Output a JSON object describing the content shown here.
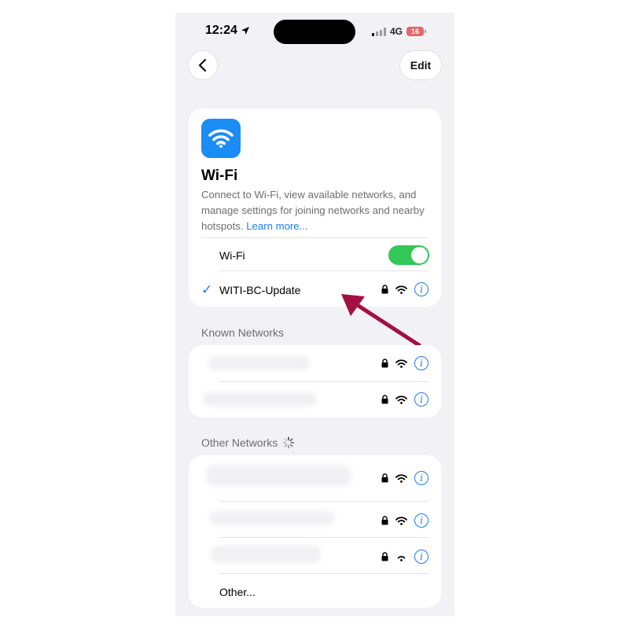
{
  "status_bar": {
    "time": "12:24",
    "network": "4G",
    "battery": "16"
  },
  "nav": {
    "edit_label": "Edit"
  },
  "wifi_card": {
    "title": "Wi-Fi",
    "description": "Connect to Wi-Fi, view available networks, and manage settings for joining networks and nearby hotspots.",
    "learn_more": "Learn more...",
    "toggle_label": "Wi-Fi",
    "toggle_on": true,
    "connected_network": "WITI-BC-Update"
  },
  "known_networks": {
    "header": "Known Networks",
    "rows": 2
  },
  "other_networks": {
    "header": "Other Networks",
    "rows": 3,
    "other_label": "Other..."
  },
  "colors": {
    "accent": "#1a7cf6",
    "toggle_on": "#34c759",
    "annotation_arrow": "#a3103f",
    "battery": "#e6676c"
  },
  "icons": [
    "location-arrow-icon",
    "chevron-left-icon",
    "wifi-icon",
    "checkmark-icon",
    "lock-icon",
    "info-icon",
    "spinner-icon"
  ]
}
